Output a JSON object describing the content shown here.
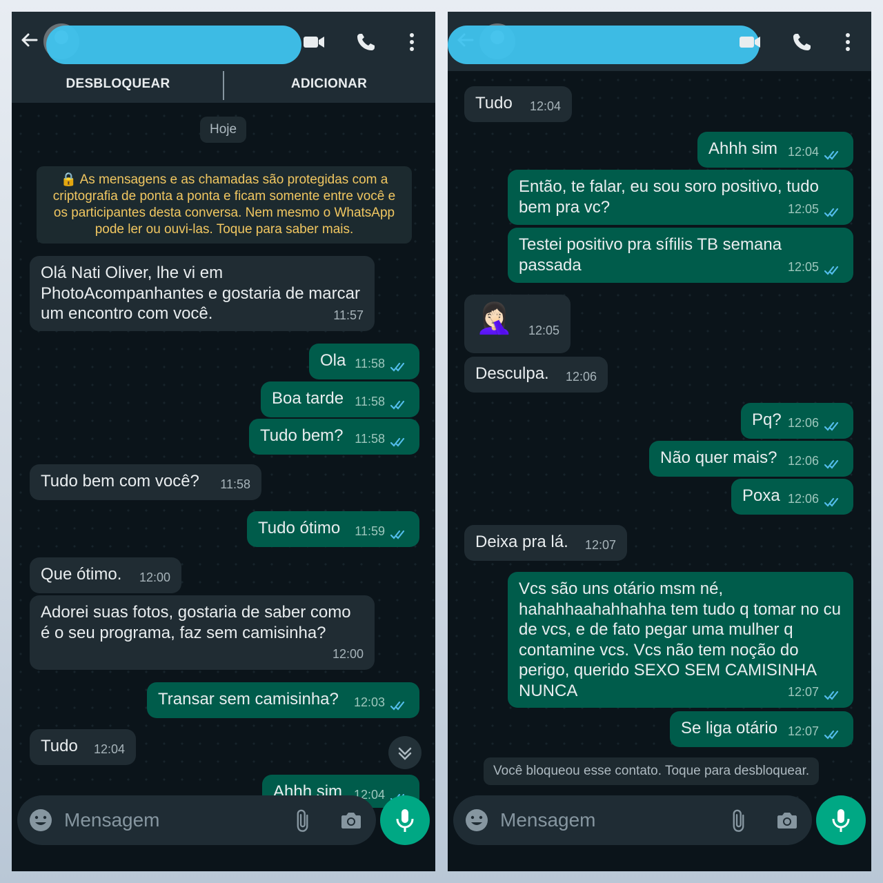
{
  "left": {
    "actions": {
      "unblock": "DESBLOQUEAR",
      "add": "ADICIONAR"
    },
    "date": "Hoje",
    "encryption": "As mensagens e as chamadas são protegidas com a criptografia de ponta a ponta e ficam somente entre você e os participantes desta conversa. Nem mesmo o WhatsApp pode ler ou ouvi-las. Toque para saber mais.",
    "messages": [
      {
        "text": "Olá Nati Oliver, lhe vi em PhotoAcompanhantes e gostaria de marcar um encontro com você.",
        "time": "11:57"
      },
      {
        "text": "Ola",
        "time": "11:58"
      },
      {
        "text": "Boa tarde",
        "time": "11:58"
      },
      {
        "text": "Tudo bem?",
        "time": "11:58"
      },
      {
        "text": "Tudo bem com você?",
        "time": "11:58"
      },
      {
        "text": "Tudo ótimo",
        "time": "11:59"
      },
      {
        "text": "Que ótimo.",
        "time": "12:00"
      },
      {
        "text": "Adorei suas fotos, gostaria de saber como é o seu programa, faz sem camisinha?",
        "time": "12:00"
      },
      {
        "text": "Transar sem camisinha?",
        "time": "12:03"
      },
      {
        "text": "Tudo",
        "time": "12:04"
      },
      {
        "text": "Ahhh sim",
        "time": "12:04"
      }
    ],
    "input_placeholder": "Mensagem"
  },
  "right": {
    "messages": [
      {
        "text": "Tudo",
        "time": "12:04"
      },
      {
        "text": "Ahhh sim",
        "time": "12:04"
      },
      {
        "text": "Então, te falar, eu sou soro positivo, tudo bem pra vc?",
        "time": "12:05"
      },
      {
        "text": "Testei positivo pra sífilis TB semana passada",
        "time": "12:05"
      },
      {
        "text": "🤦🏻‍♀️",
        "time": "12:05"
      },
      {
        "text": "Desculpa.",
        "time": "12:06"
      },
      {
        "text": "Pq?",
        "time": "12:06"
      },
      {
        "text": "Não quer mais?",
        "time": "12:06"
      },
      {
        "text": "Poxa",
        "time": "12:06"
      },
      {
        "text": "Deixa pra lá.",
        "time": "12:07"
      },
      {
        "text": "Vcs são uns otário msm né, hahahhaahahhahha tem tudo q tomar no cu de vcs, e de fato pegar uma mulher q contamine vcs. Vcs não tem noção do perigo, querido SEXO SEM CAMISINHA NUNCA",
        "time": "12:07"
      },
      {
        "text": "Se liga otário",
        "time": "12:07"
      }
    ],
    "blocked_notice": "Você bloqueou esse contato. Toque para desbloquear.",
    "input_placeholder": "Mensagem"
  },
  "colors": {
    "header": "#1f2c34",
    "chat_bg": "#0b141a",
    "incoming": "#202c33",
    "outgoing": "#005c4b",
    "read_ticks": "#53bdeb",
    "accent": "#00a884",
    "system_text": "#f1c761"
  },
  "icons": [
    "back-arrow-icon",
    "avatar",
    "video-call-icon",
    "phone-icon",
    "more-vert-icon",
    "lock-icon",
    "double-check-icon",
    "scroll-down-icon",
    "emoji-icon",
    "attach-icon",
    "camera-icon",
    "mic-icon"
  ]
}
